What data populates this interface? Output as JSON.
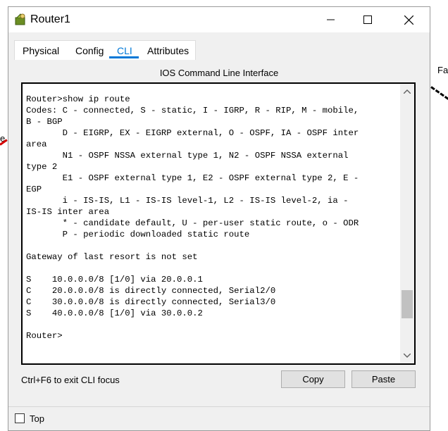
{
  "background": {
    "left_label": "e.",
    "right_label": "Fa"
  },
  "window": {
    "title": "Router1",
    "icons": {
      "app": "router-icon",
      "minimize": "minimize-icon",
      "maximize": "maximize-icon",
      "close": "close-icon"
    }
  },
  "tabs": [
    {
      "label": "Physical",
      "active": false
    },
    {
      "label": "Config",
      "active": false
    },
    {
      "label": "CLI",
      "active": true
    },
    {
      "label": "Attributes",
      "active": false
    }
  ],
  "panel_title": "IOS Command Line Interface",
  "cli": {
    "output": "Router>show ip route\nCodes: C - connected, S - static, I - IGRP, R - RIP, M - mobile,\nB - BGP\n       D - EIGRP, EX - EIGRP external, O - OSPF, IA - OSPF inter\narea\n       N1 - OSPF NSSA external type 1, N2 - OSPF NSSA external\ntype 2\n       E1 - OSPF external type 1, E2 - OSPF external type 2, E -\nEGP\n       i - IS-IS, L1 - IS-IS level-1, L2 - IS-IS level-2, ia -\nIS-IS inter area\n       * - candidate default, U - per-user static route, o - ODR\n       P - periodic downloaded static route\n\nGateway of last resort is not set\n\nS    10.0.0.0/8 [1/0] via 20.0.0.1\nC    20.0.0.0/8 is directly connected, Serial2/0\nC    30.0.0.0/8 is directly connected, Serial3/0\nS    40.0.0.0/8 [1/0] via 30.0.0.2\n\nRouter>"
  },
  "footer": {
    "hint": "Ctrl+F6 to exit CLI focus",
    "copy_label": "Copy",
    "paste_label": "Paste",
    "top_label": "Top",
    "top_checked": false
  },
  "colors": {
    "accent": "#0078d7",
    "window_bg": "#f0f0f0"
  }
}
